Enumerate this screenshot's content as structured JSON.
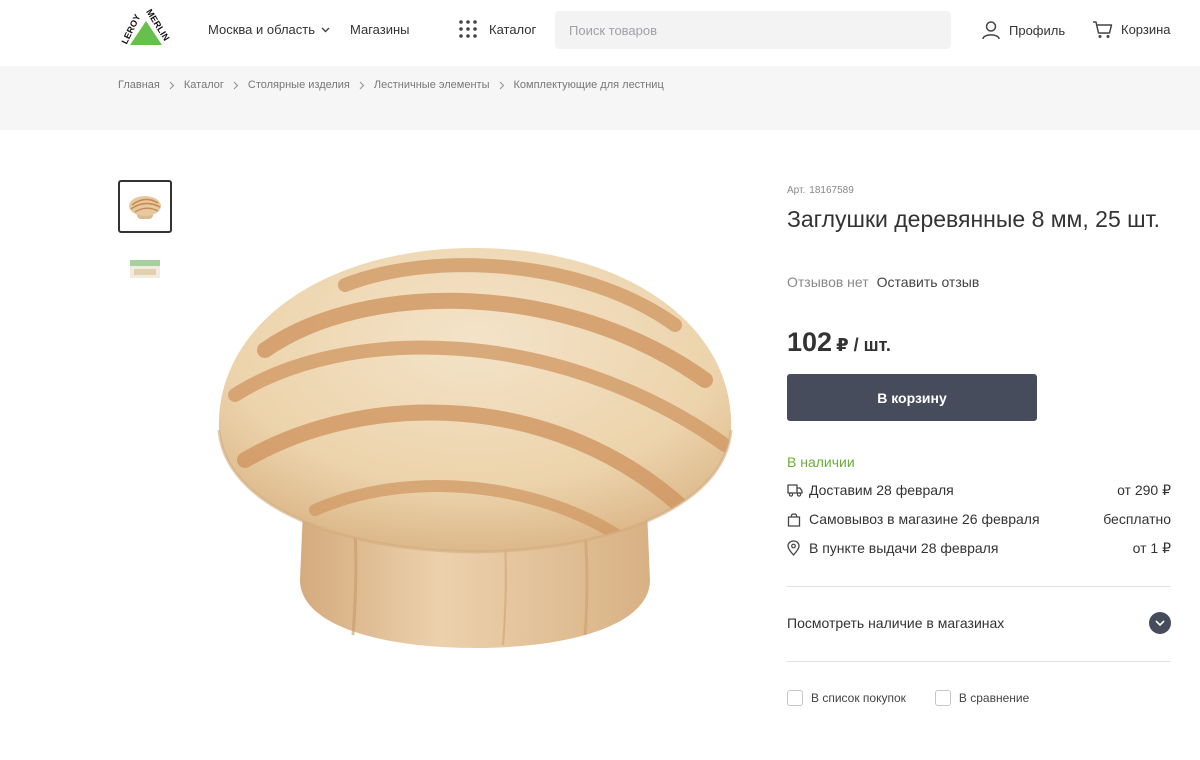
{
  "header": {
    "logo_text_left": "LEROY",
    "logo_text_right": "MERLIN",
    "region_label": "Москва и область",
    "stores_label": "Магазины",
    "catalog_label": "Каталог",
    "search_placeholder": "Поиск товаров",
    "profile_label": "Профиль",
    "cart_label": "Корзина"
  },
  "breadcrumbs": [
    "Главная",
    "Каталог",
    "Столярные изделия",
    "Лестничные элементы",
    "Комплектующие для лестниц"
  ],
  "product": {
    "article_label": "Арт.",
    "article_number": "18167589",
    "title": "Заглушки деревянные 8 мм, 25 шт.",
    "reviews_none": "Отзывов нет",
    "leave_review": "Оставить отзыв",
    "price": "102",
    "price_unit": "₽ / шт.",
    "buy_button": "В корзину",
    "stock_status": "В наличии",
    "delivery": [
      {
        "icon": "truck-icon",
        "text": "Доставим 28 февраля",
        "cost": "от 290 ₽"
      },
      {
        "icon": "bag-icon",
        "text": "Самовывоз в магазине 26 февраля",
        "cost": "бесплатно"
      },
      {
        "icon": "location-pin-icon",
        "text": "В пункте выдачи 28 февраля",
        "cost": "от 1 ₽"
      }
    ],
    "store_availability": "Посмотреть наличие в магазинах",
    "shopping_list": "В список покупок",
    "compare": "В сравнение"
  },
  "colors": {
    "accent_green": "#6bae3b",
    "button_dark": "#464c5c",
    "logo_green": "#66c04b"
  }
}
